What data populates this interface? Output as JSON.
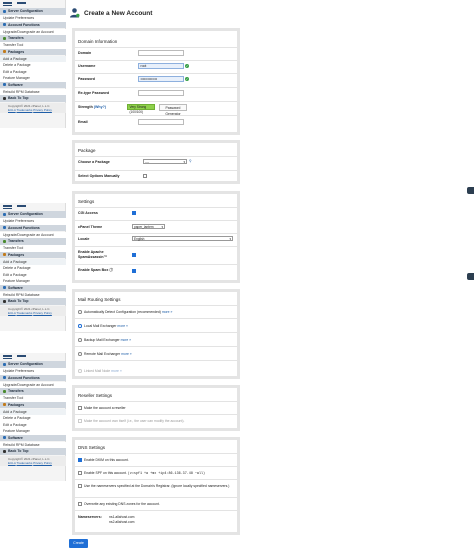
{
  "page": {
    "title": "Create a New Account"
  },
  "sidebar": {
    "items": [
      {
        "label": "Server Configuration",
        "type": "head",
        "icon": "server-icon",
        "color": "#2c6db3"
      },
      {
        "label": "Update Preferences",
        "type": "item"
      },
      {
        "label": "Account Functions",
        "type": "head",
        "icon": "user-icon",
        "color": "#2c6db3"
      },
      {
        "label": "Upgrade/Downgrade an Account",
        "type": "item"
      },
      {
        "label": "Transfers",
        "type": "head",
        "icon": "transfer-icon",
        "color": "#4a8a2f"
      },
      {
        "label": "Transfer Tool",
        "type": "item"
      },
      {
        "label": "Packages",
        "type": "head",
        "icon": "package-icon",
        "color": "#c27b1c"
      },
      {
        "label": "Add a Package",
        "type": "sub"
      },
      {
        "label": "Delete a Package",
        "type": "item"
      },
      {
        "label": "Edit a Package",
        "type": "item"
      },
      {
        "label": "Feature Manager",
        "type": "item"
      },
      {
        "label": "Software",
        "type": "head",
        "icon": "software-icon",
        "color": "#2c6db3"
      },
      {
        "label": "Rebuild RPM Database",
        "type": "item"
      },
      {
        "label": "Back To Top",
        "type": "head",
        "icon": "back-to-top-icon",
        "color": "#333333"
      }
    ],
    "copyright": "Copyright© 2021 cPanel, L.L.C.",
    "eula": "EULA",
    "trademarks": "Trademarks",
    "privacy": "Privacy Policy"
  },
  "domain_info": {
    "heading": "Domain Information",
    "domain_label": "Domain",
    "username_label": "Username",
    "username_value": "root",
    "password_label": "Password",
    "password_value": "••••••••••••••",
    "retype_label": "Re-type Password",
    "strength_label": "Strength",
    "strength_why": "(Why?)",
    "strength_value": "Very Strong (100/100)",
    "password_generator": "Password Generator",
    "email_label": "Email"
  },
  "package": {
    "heading": "Package",
    "choose_label": "Choose a Package",
    "choose_value": "----",
    "select_manually": "Select Options Manually"
  },
  "settings": {
    "heading": "Settings",
    "cgi_label": "CGI Access",
    "theme_label": "cPanel Theme",
    "theme_value": "paper_lantern",
    "locale_label": "Locale",
    "locale_value": "English",
    "apache_label": "Enable Apache",
    "apache_label2": "SpamAssassin™",
    "spambox_label": "Enable Spam Box"
  },
  "mail_routing": {
    "heading": "Mail Routing Settings",
    "options": [
      {
        "label": "Automatically Detect Configuration (recommended)",
        "more": "more »",
        "checked": false
      },
      {
        "label": "Local Mail Exchanger",
        "more": "more »",
        "checked": true
      },
      {
        "label": "Backup Mail Exchanger",
        "more": "more »",
        "checked": false
      },
      {
        "label": "Remote Mail Exchanger",
        "more": "more »",
        "checked": false
      }
    ],
    "linked_label": "Linked Mail Node",
    "linked_more": "more »"
  },
  "reseller": {
    "heading": "Reseller Settings",
    "make_reseller": "Make the account a reseller",
    "own_itself": "Make the account own itself (i.e., the user can modify the account)."
  },
  "dns": {
    "heading": "DNS Settings",
    "dkim": "Enable DKIM on this account.",
    "spf_prefix": "Enable SPF on this account.",
    "spf_record": "(v=spf1 +a +mx +ip4:86.136.37.48 ~all)",
    "registrar": "Use the nameservers specified at the Domain's Registrar. (Ignore locally specified nameservers.)",
    "overwrite": "Overwrite any existing DNS zones for the account.",
    "nameservers_label": "Nameservers",
    "ns1": "ns1.allahost.com",
    "ns2": "ns2.allahost.com"
  },
  "actions": {
    "create": "Create"
  },
  "colors": {
    "accent": "#1f6fd6",
    "success": "#3aa04a",
    "strength": "#8ed04a",
    "sidebar_head": "#cfd6de"
  }
}
